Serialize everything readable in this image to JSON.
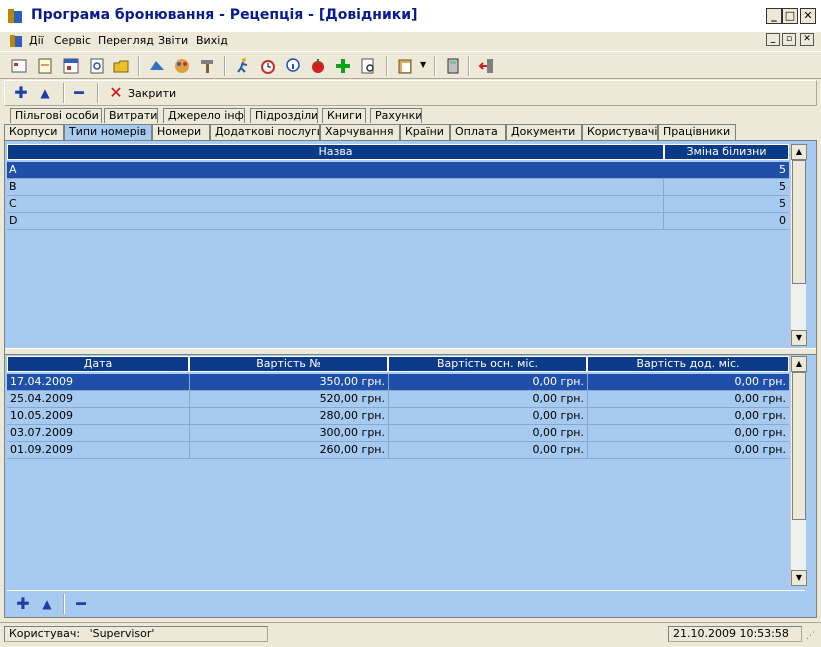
{
  "window": {
    "title": "Програма бронювання - Рецепція - [Довідники]"
  },
  "menu": {
    "items": [
      "Дії",
      "Сервіс",
      "Перегляд",
      "Звіти",
      "Вихід"
    ]
  },
  "action_toolbar": {
    "close_label": "Закрити"
  },
  "tabs": {
    "back_row": [
      "Пільгові особи",
      "Витрати",
      "Джерело інф.",
      "Підрозділи",
      "Книги",
      "Рахунки"
    ],
    "front_row": [
      "Корпуси",
      "Типи номерів",
      "Номери",
      "Додаткові послуги",
      "Харчування",
      "Країни",
      "Оплата",
      "Документи",
      "Користувачі",
      "Працівники"
    ],
    "active": "Типи номерів"
  },
  "room_types": {
    "columns": [
      "Назва",
      "Зміна білизни"
    ],
    "rows": [
      {
        "name": "A",
        "linen": "5"
      },
      {
        "name": "B",
        "linen": "5"
      },
      {
        "name": "C",
        "linen": "5"
      },
      {
        "name": "D",
        "linen": "0"
      }
    ]
  },
  "prices": {
    "columns": [
      "Дата",
      "Вартість №",
      "Вартість осн. міс.",
      "Вартість дод. міс."
    ],
    "rows": [
      {
        "date": "17.04.2009",
        "room": "350,00 грн.",
        "main": "0,00 грн.",
        "extra": "0,00 грн."
      },
      {
        "date": "25.04.2009",
        "room": "520,00 грн.",
        "main": "0,00 грн.",
        "extra": "0,00 грн."
      },
      {
        "date": "10.05.2009",
        "room": "280,00 грн.",
        "main": "0,00 грн.",
        "extra": "0,00 грн."
      },
      {
        "date": "03.07.2009",
        "room": "300,00 грн.",
        "main": "0,00 грн.",
        "extra": "0,00 грн."
      },
      {
        "date": "01.09.2009",
        "room": "260,00 грн.",
        "main": "0,00 грн.",
        "extra": "0,00 грн."
      }
    ]
  },
  "status": {
    "user_label": "Користувач:",
    "user_value": "'Supervisor'",
    "datetime": "21.10.2009 10:53:58"
  },
  "colors": {
    "grid_bg": "#a6caf0",
    "header_bg": "#0a3a88",
    "selection": "#1f4fa8",
    "title_text": "#0a1a90"
  }
}
